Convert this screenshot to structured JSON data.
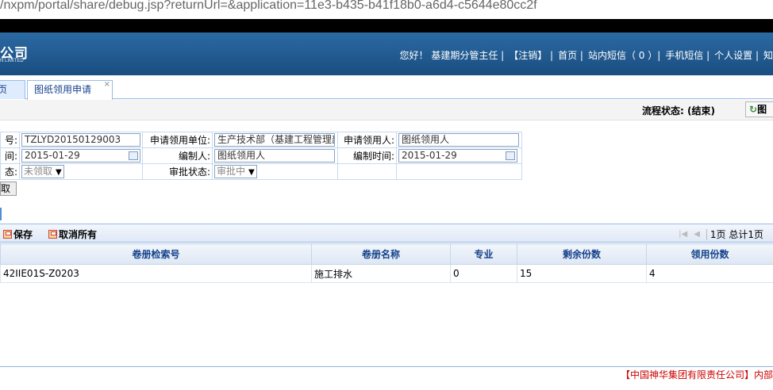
{
  "url": "/nxpm/portal/share/debug.jsp?returnUrl=&application=11e3-b435-b41f18b0-a6d4-c5644e80cc2f",
  "header": {
    "logo_text": "公司",
    "logo_sub": "N LIMITED",
    "nav": [
      "您好！ 基建期分管主任 |",
      "【注销】 |",
      "首页 |",
      "站内短信（ 0 ）|",
      "手机短信 |",
      "个人设置 |",
      "知"
    ]
  },
  "tabs": [
    {
      "label": "页"
    },
    {
      "label": "图纸领用申请",
      "close": "×"
    }
  ],
  "flow": {
    "status_label": "流程状态: (结束)",
    "button_label": "图"
  },
  "form": {
    "row1": {
      "l1": "号:",
      "v1": "TZLYD20150129003",
      "l2": "申请领用单位:",
      "v2": "生产技术部（基建工程管理部）",
      "l3": "申请领用人:",
      "v3": "图纸领用人"
    },
    "row2": {
      "l1": "间:",
      "v1": "2015-01-29",
      "l2": "编制人:",
      "v2": "图纸领用人",
      "l3": "编制时间:",
      "v3": "2015-01-29"
    },
    "row3": {
      "l1": "态:",
      "v1": "未领取",
      "l2": "审批状态:",
      "v2": "审批中"
    }
  },
  "small_button": "取",
  "toolbar": {
    "save": "保存",
    "cancel_all": "取消所有",
    "pager": "1页 总计1页"
  },
  "grid": {
    "headers": [
      "卷册检索号",
      "卷册名称",
      "专业",
      "剩余份数",
      "领用份数"
    ],
    "rows": [
      [
        "42IIE01S-Z0203",
        "施工排水",
        "0",
        "15",
        "4"
      ]
    ]
  },
  "footer": "【中国神华集团有限责任公司】内部"
}
